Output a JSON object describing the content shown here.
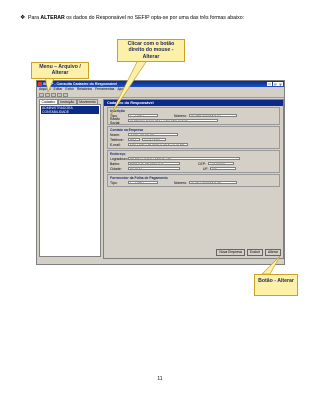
{
  "intro": {
    "bullet": "❖",
    "text_before": "Para ",
    "text_bold": "ALTERAR",
    "text_after": " os dados do Responsável no SEFIP opta-se por uma das três formas abaixo:"
  },
  "callouts": {
    "top": "Clicar com o botão direito do mouse - Alterar",
    "left": "Menu – Arquivo / Alterar",
    "bottom": "Botão - Alterar"
  },
  "window": {
    "title": "SEFIP - Consulta Cadastro do Responsável",
    "menu": [
      "Arquivo",
      "Editar",
      "Exibir",
      "Relatórios",
      "Ferramentas",
      "Ajuda"
    ],
    "tabs": [
      "Cadastro",
      "Instrução",
      "Movimento"
    ],
    "tree_item": "ADMINISTRADORA CONTABILIDADE",
    "form_title": "Cadastro do Responsável",
    "groups": {
      "inscricao": {
        "title": "Inscrição",
        "tipo_label": "Tipo:",
        "tipo_value": "1 - CNPJ",
        "numero_label": "Número:",
        "numero_value": "01.999.000/0003-61",
        "razao_label": "Razão Social:",
        "razao_value": "ADMINISTRADORA CONTABILIDADE"
      },
      "contato": {
        "title": "Contato na Empresa",
        "nome_label": "Nome:",
        "nome_value": "JOSÉ DA SILVA",
        "telefone_label": "Telefone:",
        "ddd_value": "(61)",
        "telefone_value": "3224-0000",
        "email_label": "E-mail:",
        "email_value": "FISCO@CONTABILIDADE.GOV.BR"
      },
      "endereco": {
        "title": "Endereço",
        "logradouro_label": "Logradouro:",
        "logradouro_value": "AV NECLIDES LEMOS 780",
        "bairro_label": "Bairro:",
        "bairro_value": "PARQUE ANTARTICA",
        "cep_label": "CEP:",
        "cep_value": "73310000",
        "cidade_label": "Cidade:",
        "cidade_value": "AGUDO",
        "uf_label": "UF:",
        "uf_value": "RS"
      },
      "fornecedor": {
        "title": "Fornecedor da Folha de Pagamento",
        "tipo_label": "Tipo:",
        "tipo_value": "1 - CNPJ",
        "numero_label": "Número:",
        "numero_value": "01.901.000/0003-66"
      }
    },
    "buttons": [
      "Nova Empresa",
      "Excluir",
      "Alterar"
    ]
  },
  "page_number": "11"
}
